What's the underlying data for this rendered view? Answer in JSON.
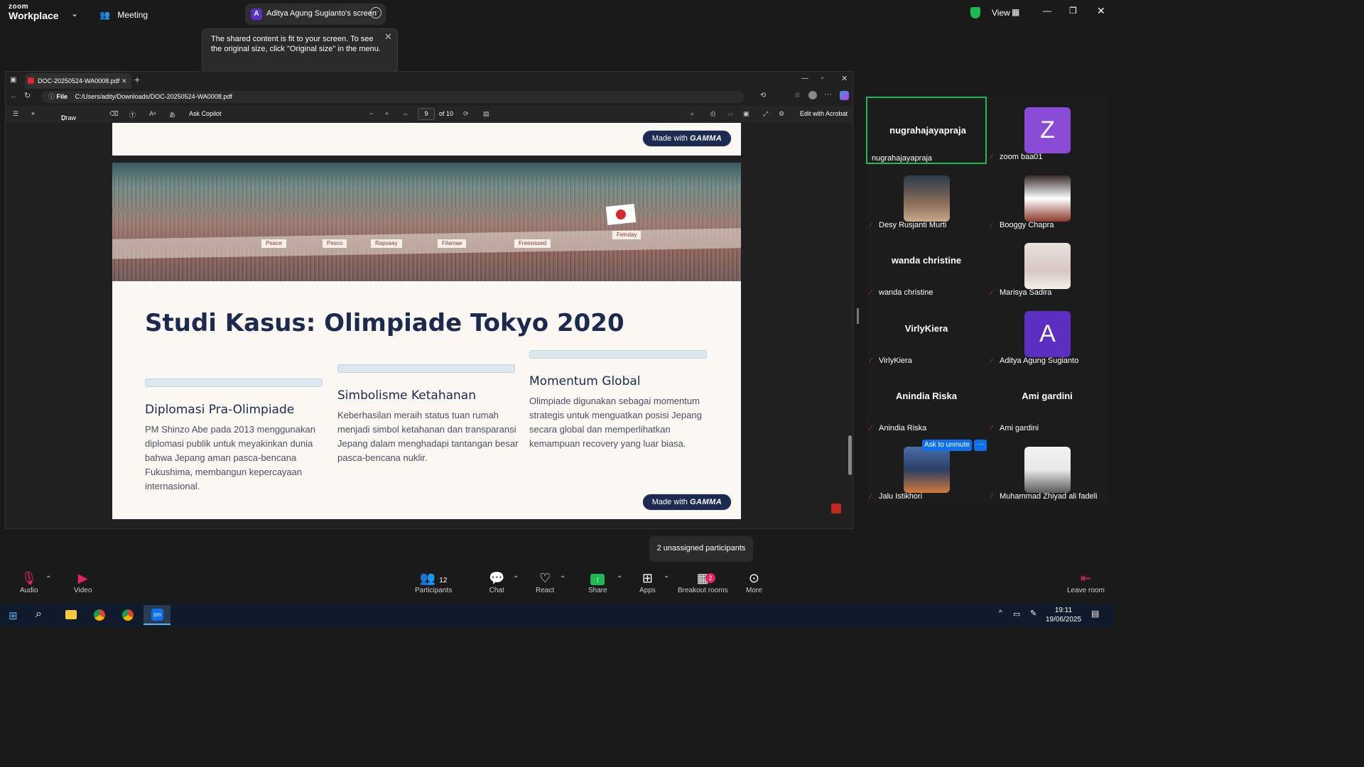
{
  "zoom": {
    "logo_line1": "zoom",
    "logo_line2": "Workplace",
    "meeting_label": "Meeting",
    "share_owner_initial": "A",
    "share_label": "Aditya Agung Sugianto's screen",
    "view_label": "View",
    "tooltip": "The shared content is fit to your screen. To see the original size, click \"Original size\" in the menu."
  },
  "browser": {
    "tab_title": "DOC-20250524-WA0008.pdf",
    "url_scheme": "File",
    "url": "C:/Users/adity/Downloads/DOC-20250524-WA0008.pdf"
  },
  "pdf_toolbar": {
    "draw": "Draw",
    "ask_copilot": "Ask Copilot",
    "page_current": "9",
    "page_total": "of 10",
    "edit_acrobat": "Edit with Acrobat"
  },
  "slide": {
    "made_with": "Made with",
    "gamma": "GAMMA",
    "title": "Studi Kasus: Olimpiade Tokyo 2020",
    "banners": [
      "Peace",
      "Pesco",
      "Rapvaay",
      "Filamae",
      "Freewssed",
      "Feinday"
    ],
    "columns": [
      {
        "heading": "Diplomasi Pra-Olimpiade",
        "text": "PM Shinzo Abe pada 2013 menggunakan diplomasi publik untuk meyakinkan dunia bahwa Jepang aman pasca-bencana Fukushima, membangun kepercayaan internasional."
      },
      {
        "heading": "Simbolisme Ketahanan",
        "text": "Keberhasilan meraih status tuan rumah menjadi simbol ketahanan dan transparansi Jepang dalam menghadapi tantangan besar pasca-bencana nuklir."
      },
      {
        "heading": "Momentum Global",
        "text": "Olimpiade digunakan sebagai momentum strategis untuk menguatkan posisi Jepang secara global dan memperlihatkan kemampuan recovery yang luar biasa."
      }
    ]
  },
  "participants": [
    {
      "big": "nugrahajayapraja",
      "name": "nugrahajayapraja",
      "muted": false,
      "active": true
    },
    {
      "big": "Z",
      "name": "zoom baa01",
      "muted": true,
      "avatar_color": "#8a4bd6"
    },
    {
      "big": "",
      "name": "Desy Rusjanti Murti",
      "muted": true
    },
    {
      "big": "",
      "name": "Booggy Chapra",
      "muted": true
    },
    {
      "big": "wanda christine",
      "name": "wanda christine",
      "muted": true
    },
    {
      "big": "",
      "name": "Marisya Sadira",
      "muted": true
    },
    {
      "big": "VirlyKiera",
      "name": "VirlyKiera",
      "muted": true
    },
    {
      "big": "A",
      "name": "Aditya Agung Sugianto",
      "muted": true,
      "avatar_color": "#5a2fc2"
    },
    {
      "big": "Anindia Riska",
      "name": "Anindia Riska",
      "muted": true
    },
    {
      "big": "Ami gardini",
      "name": "Ami gardini",
      "muted": true
    },
    {
      "big": "",
      "name": "Jalu Istikhori",
      "muted": true
    },
    {
      "big": "",
      "name": "Muhammad Zhiyad ali fadeli",
      "muted": true
    }
  ],
  "ask_to_unmute": "Ask to unmute",
  "unassigned": "2 unassigned participants",
  "toolbar": {
    "audio": "Audio",
    "video": "Video",
    "participants": "Participants",
    "participants_count": "12",
    "chat": "Chat",
    "react": "React",
    "share": "Share",
    "apps": "Apps",
    "breakout": "Breakout rooms",
    "breakout_badge": "2",
    "more": "More",
    "leave": "Leave room"
  },
  "taskbar": {
    "time": "19:11",
    "date": "19/06/2025"
  }
}
